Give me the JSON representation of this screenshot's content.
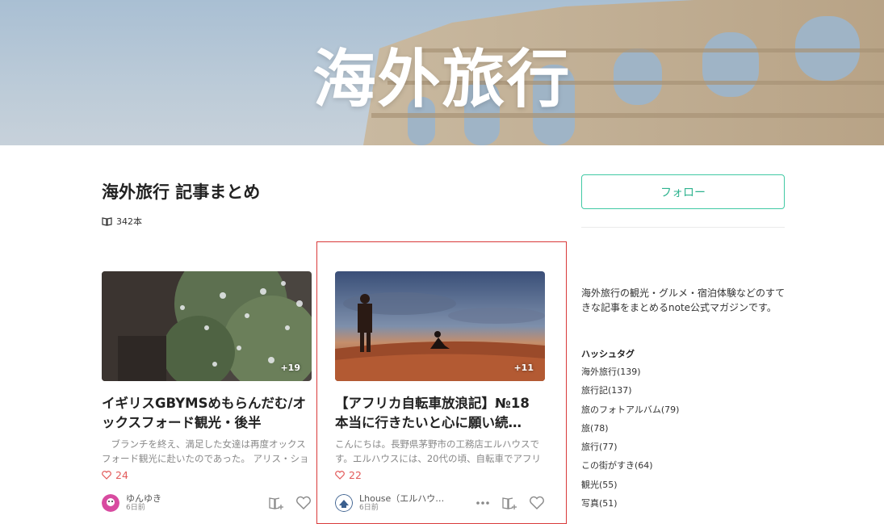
{
  "hero": {
    "title": "海外旅行"
  },
  "magazine": {
    "title": "海外旅行 記事まとめ",
    "count": "342本",
    "count_icon": "book-icon"
  },
  "cards": [
    {
      "extra_images": "+19",
      "title": "イギリスGBYMSめもらんだむ/オックスフォード観光・後半",
      "excerpt": "　ブランチを終え、満足した女達は再度オックスフォード観光に赴いたのであった。 アリス・ショップ…",
      "likes": "24",
      "author": "ゆんゆき",
      "time": "6日前"
    },
    {
      "extra_images": "+11",
      "title": "【アフリカ自転車放浪記】№18 本当に行きたいと心に願い続…",
      "excerpt": "こんにちは。長野県茅野市の工務店エルハウスです。エルハウスには、20代の頃、自転車でアフリカを旅…",
      "likes": "22",
      "author": "Lhouse（エルハウ…",
      "time": "6日前"
    }
  ],
  "sidebar": {
    "follow_label": "フォロー",
    "description": "海外旅行の観光・グルメ・宿泊体験などのすてきな記事をまとめるnote公式マガジンです。",
    "hashtag_heading": "ハッシュタグ",
    "hashtags": [
      "海外旅行(139)",
      "旅行記(137)",
      "旅のフォトアルバム(79)",
      "旅(78)",
      "旅行(77)",
      "この街がすき(64)",
      "観光(55)",
      "写真(51)"
    ]
  },
  "colors": {
    "accent": "#41c9a4",
    "like": "#e35b5b",
    "highlight": "#d93a3a"
  }
}
